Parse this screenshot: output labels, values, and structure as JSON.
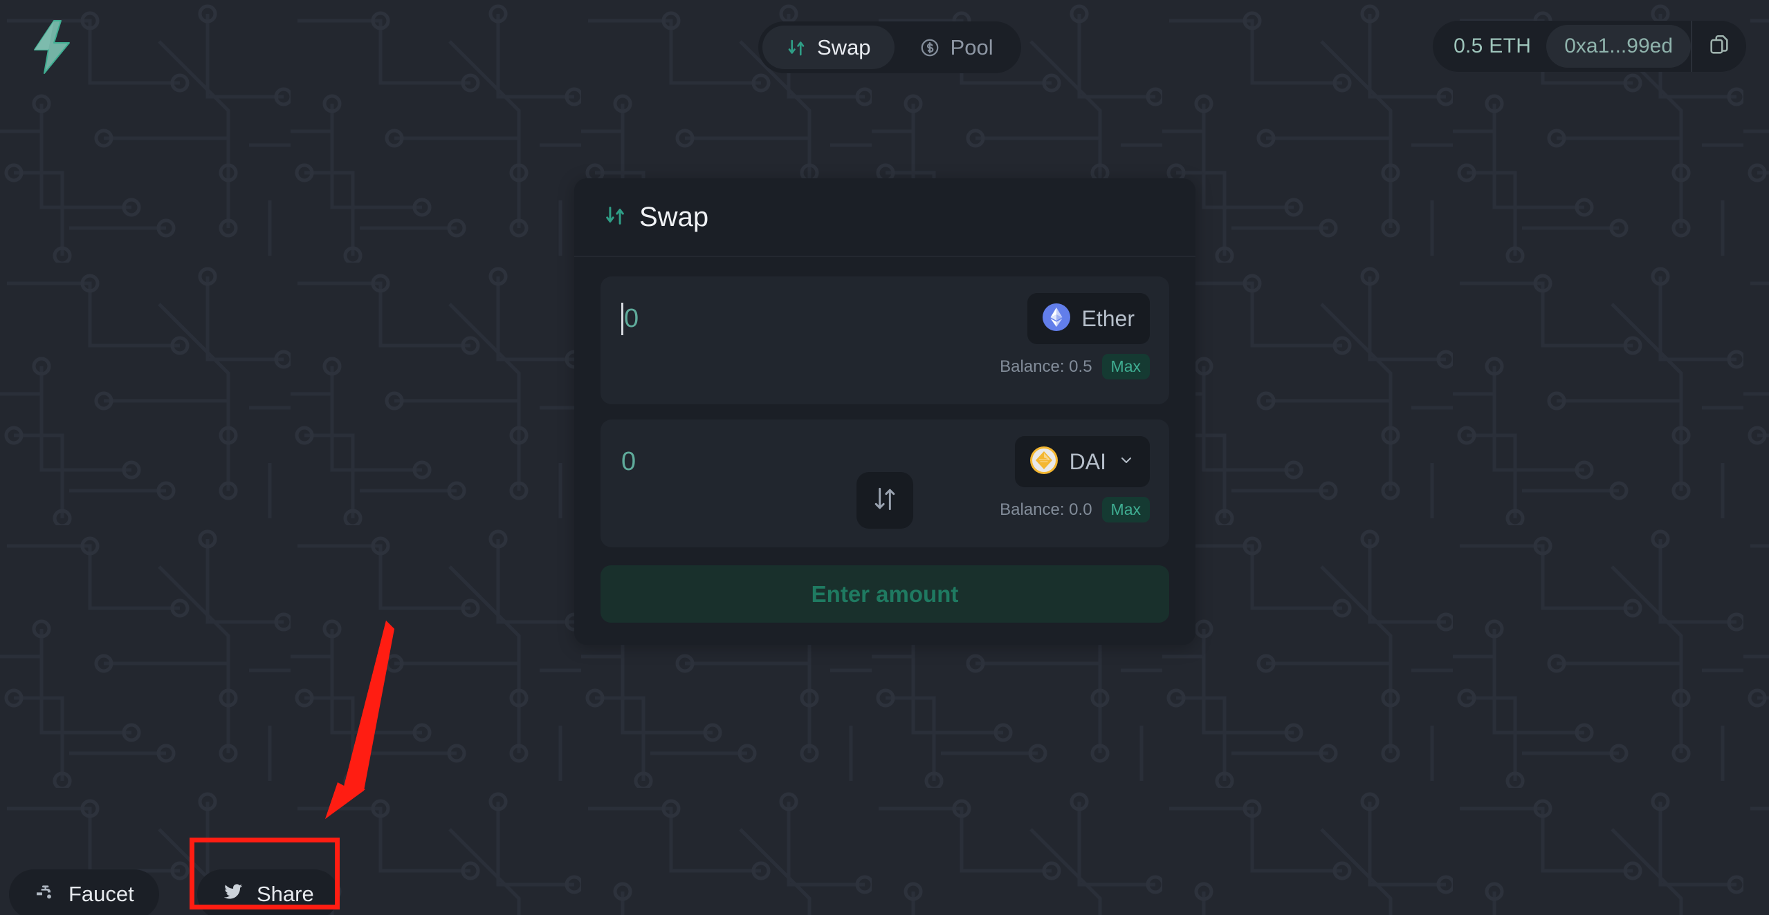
{
  "app": {
    "logo_icon": "lightning-bolt-icon",
    "background_pattern": "circuit-board",
    "bg_color": "#23272f",
    "accent_color": "#3fae92"
  },
  "header": {
    "tabs": [
      {
        "label": "Swap",
        "icon": "swap-arrows-icon",
        "active": true
      },
      {
        "label": "Pool",
        "icon": "dollar-circle-icon",
        "active": false
      }
    ],
    "wallet": {
      "balance": "0.5 ETH",
      "address": "0xa1...99ed",
      "copy_icon": "copy-icon"
    }
  },
  "swap_card": {
    "title": "Swap",
    "title_icon": "swap-arrows-icon",
    "from": {
      "amount_placeholder": "0",
      "amount_value": "",
      "token": "Ether",
      "token_icon": "ethereum-icon",
      "has_dropdown": false,
      "balance_label": "Balance: 0.5",
      "max_label": "Max"
    },
    "to": {
      "amount_placeholder": "0",
      "amount_value": "",
      "token": "DAI",
      "token_icon": "dai-icon",
      "has_dropdown": true,
      "balance_label": "Balance: 0.0",
      "max_label": "Max"
    },
    "toggle_icon": "down-up-arrows-icon",
    "submit_label": "Enter amount"
  },
  "footer": {
    "faucet_label": "Faucet",
    "faucet_icon": "faucet-tap-icon",
    "share_label": "Share",
    "share_icon": "twitter-bird-icon"
  },
  "annotation": {
    "color": "#ff1d12",
    "target": "share-button",
    "shapes": [
      "highlight-box",
      "pointer-arrow"
    ]
  }
}
